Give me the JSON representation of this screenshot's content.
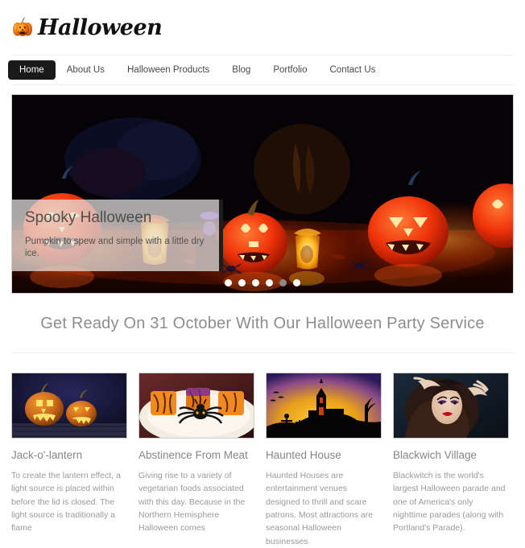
{
  "site": {
    "logo_text": "Halloween",
    "logo_icon": "pumpkin-icon"
  },
  "nav": {
    "items": [
      {
        "label": "Home",
        "active": true
      },
      {
        "label": "About Us",
        "active": false
      },
      {
        "label": "Halloween Products",
        "active": false
      },
      {
        "label": "Blog",
        "active": false
      },
      {
        "label": "Portfolio",
        "active": false
      },
      {
        "label": "Contact Us",
        "active": false
      }
    ]
  },
  "hero": {
    "image_alt": "glowing carved jack-o-lanterns and candle jars on a dark table",
    "caption_title": "Spooky Halloween",
    "caption_subtitle": "Pumpkin to spew and simple with a little dry ice.",
    "dots": [
      {
        "active": false
      },
      {
        "active": false
      },
      {
        "active": false
      },
      {
        "active": false
      },
      {
        "active": true
      },
      {
        "active": false
      }
    ]
  },
  "section": {
    "heading": "Get Ready On 31 October With Our Halloween Party Service"
  },
  "cards": [
    {
      "image_alt": "two lit carved pumpkins on wooden boards",
      "title": "Jack-o'-lantern",
      "body": "To create the lantern effect, a light source is placed within before the lid is closed. The light source is traditionally a flame"
    },
    {
      "image_alt": "orange frosted halloween cakes with a plastic spider on a plate",
      "title": "Abstinence From Meat",
      "body": "Giving rise to a variety of vegetarian foods associated with this day. Because in the Northern Hemisphere Halloween comes"
    },
    {
      "image_alt": "silhouette of a haunted church and graveyard against an orange sky",
      "title": "Haunted House",
      "body": "Haunted Houses are entertainment venues designed to thrill and scare patrons. Most attractions are seasonal Halloween businesses."
    },
    {
      "image_alt": "woman in dark gothic makeup with long hair",
      "title": "Blackwich Village",
      "body": "Blackwitch is the world's largest Halloween parade and one of America's only nighttime parades (along with Portland's Parade)."
    }
  ],
  "colors": {
    "accent_dark": "#1a1a1a",
    "text_muted": "#9a9a9a",
    "rule": "#efefef",
    "pumpkin_orange": "#f07b12"
  }
}
